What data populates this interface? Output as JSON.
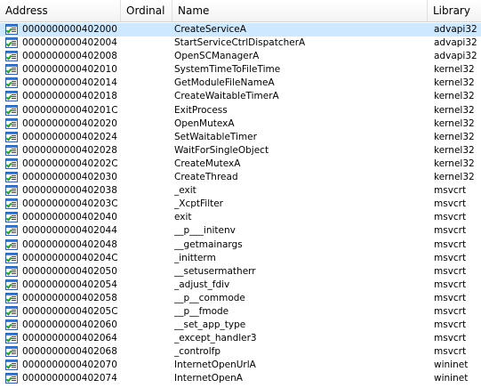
{
  "columns": {
    "address": "Address",
    "ordinal": "Ordinal",
    "name": "Name",
    "library": "Library"
  },
  "row_icon": "import-function-icon",
  "selected_row": 0,
  "rows": [
    {
      "address": "0000000000402000",
      "ordinal": "",
      "name": "CreateServiceA",
      "library": "advapi32"
    },
    {
      "address": "0000000000402004",
      "ordinal": "",
      "name": "StartServiceCtrlDispatcherA",
      "library": "advapi32"
    },
    {
      "address": "0000000000402008",
      "ordinal": "",
      "name": "OpenSCManagerA",
      "library": "advapi32"
    },
    {
      "address": "0000000000402010",
      "ordinal": "",
      "name": "SystemTimeToFileTime",
      "library": "kernel32"
    },
    {
      "address": "0000000000402014",
      "ordinal": "",
      "name": "GetModuleFileNameA",
      "library": "kernel32"
    },
    {
      "address": "0000000000402018",
      "ordinal": "",
      "name": "CreateWaitableTimerA",
      "library": "kernel32"
    },
    {
      "address": "000000000040201C",
      "ordinal": "",
      "name": "ExitProcess",
      "library": "kernel32"
    },
    {
      "address": "0000000000402020",
      "ordinal": "",
      "name": "OpenMutexA",
      "library": "kernel32"
    },
    {
      "address": "0000000000402024",
      "ordinal": "",
      "name": "SetWaitableTimer",
      "library": "kernel32"
    },
    {
      "address": "0000000000402028",
      "ordinal": "",
      "name": "WaitForSingleObject",
      "library": "kernel32"
    },
    {
      "address": "000000000040202C",
      "ordinal": "",
      "name": "CreateMutexA",
      "library": "kernel32"
    },
    {
      "address": "0000000000402030",
      "ordinal": "",
      "name": "CreateThread",
      "library": "kernel32"
    },
    {
      "address": "0000000000402038",
      "ordinal": "",
      "name": "_exit",
      "library": "msvcrt"
    },
    {
      "address": "000000000040203C",
      "ordinal": "",
      "name": "_XcptFilter",
      "library": "msvcrt"
    },
    {
      "address": "0000000000402040",
      "ordinal": "",
      "name": "exit",
      "library": "msvcrt"
    },
    {
      "address": "0000000000402044",
      "ordinal": "",
      "name": "__p___initenv",
      "library": "msvcrt"
    },
    {
      "address": "0000000000402048",
      "ordinal": "",
      "name": "__getmainargs",
      "library": "msvcrt"
    },
    {
      "address": "000000000040204C",
      "ordinal": "",
      "name": "_initterm",
      "library": "msvcrt"
    },
    {
      "address": "0000000000402050",
      "ordinal": "",
      "name": "__setusermatherr",
      "library": "msvcrt"
    },
    {
      "address": "0000000000402054",
      "ordinal": "",
      "name": "_adjust_fdiv",
      "library": "msvcrt"
    },
    {
      "address": "0000000000402058",
      "ordinal": "",
      "name": "__p__commode",
      "library": "msvcrt"
    },
    {
      "address": "000000000040205C",
      "ordinal": "",
      "name": "__p__fmode",
      "library": "msvcrt"
    },
    {
      "address": "0000000000402060",
      "ordinal": "",
      "name": "__set_app_type",
      "library": "msvcrt"
    },
    {
      "address": "0000000000402064",
      "ordinal": "",
      "name": "_except_handler3",
      "library": "msvcrt"
    },
    {
      "address": "0000000000402068",
      "ordinal": "",
      "name": "_controlfp",
      "library": "msvcrt"
    },
    {
      "address": "0000000000402070",
      "ordinal": "",
      "name": "InternetOpenUrlA",
      "library": "wininet"
    },
    {
      "address": "0000000000402074",
      "ordinal": "",
      "name": "InternetOpenA",
      "library": "wininet"
    }
  ]
}
